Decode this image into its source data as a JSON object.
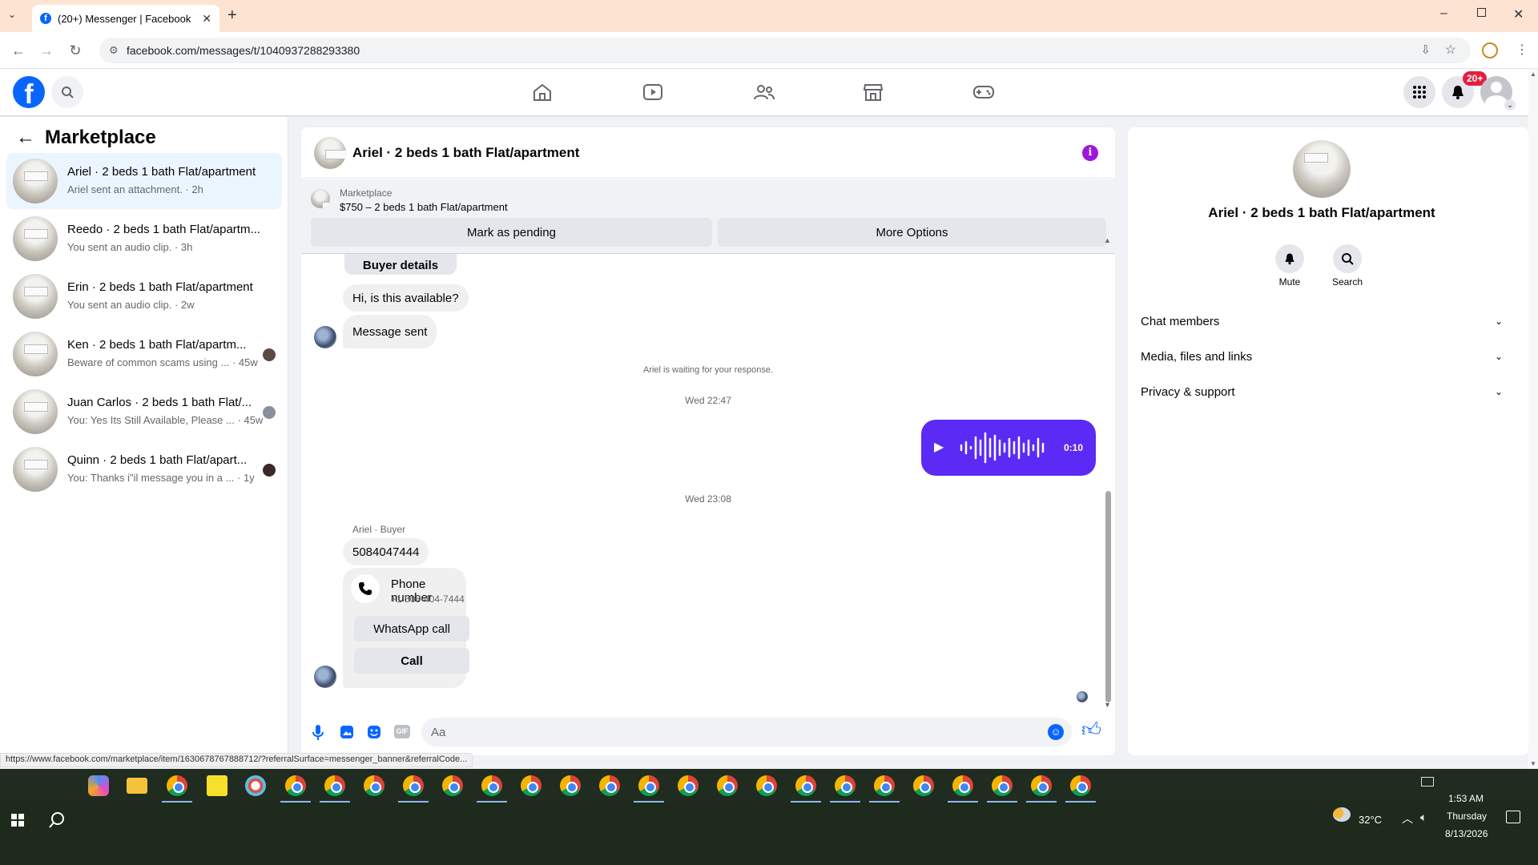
{
  "browser": {
    "tab_title": "(20+) Messenger | Facebook",
    "url": "facebook.com/messages/t/1040937288293380",
    "status_url": "https://www.facebook.com/marketplace/item/1630678767888712/?referralSurface=messenger_banner&referralCode..."
  },
  "header": {
    "notification_badge": "20+"
  },
  "sidebar": {
    "title": "Marketplace",
    "conversations": [
      {
        "title": "Ariel · 2 beds 1 bath Flat/apartment",
        "subtitle": "Ariel sent an attachment. · 2h"
      },
      {
        "title": "Reedo · 2 beds 1 bath Flat/apartm...",
        "subtitle": "You sent an audio clip. · 3h"
      },
      {
        "title": "Erin · 2 beds 1 bath Flat/apartment",
        "subtitle": "You sent an audio clip. · 2w"
      },
      {
        "title": "Ken · 2 beds 1 bath Flat/apartm...",
        "subtitle": "Beware of common scams using ... · 45w"
      },
      {
        "title": "Juan Carlos · 2 beds 1 bath Flat/...",
        "subtitle": "You: Yes Its Still Available, Please ... · 45w"
      },
      {
        "title": "Quinn · 2 beds 1 bath Flat/apart...",
        "subtitle": "You: Thanks i\"il message you in a ... · 1y"
      }
    ]
  },
  "chat": {
    "title": "Ariel · 2 beds 1 bath Flat/apartment",
    "banner_label": "Marketplace",
    "banner_listing": "$750 – 2 beds 1 bath Flat/apartment",
    "mark_pending": "Mark as pending",
    "more_options": "More Options",
    "buyer_details": "Buyer details",
    "msg_available": "Hi, is this available?",
    "msg_sent": "Message sent",
    "waiting": "Ariel is waiting for your response.",
    "ts1": "Wed 22:47",
    "audio_duration": "0:10",
    "ts2": "Wed 23:08",
    "sender_label": "Ariel · Buyer",
    "msg_phone": "5084047444",
    "phone_card_title": "Phone number",
    "phone_card_number": "+1 508-404-7444",
    "whatsapp_call": "WhatsApp call",
    "call": "Call",
    "composer_placeholder": "Aa"
  },
  "info": {
    "title": "Ariel · 2 beds 1 bath Flat/apartment",
    "mute": "Mute",
    "search": "Search",
    "sections": [
      "Chat members",
      "Media, files and links",
      "Privacy & support"
    ]
  },
  "taskbar": {
    "time": "1:53 AM",
    "day": "Thursday",
    "date": "8/13/2026",
    "temp": "32°C"
  },
  "colors": {
    "fb_blue": "#0866ff",
    "accent_purple": "#5b2bf5",
    "info_purple": "#9d17d9",
    "badge_red": "#e41e3f"
  }
}
